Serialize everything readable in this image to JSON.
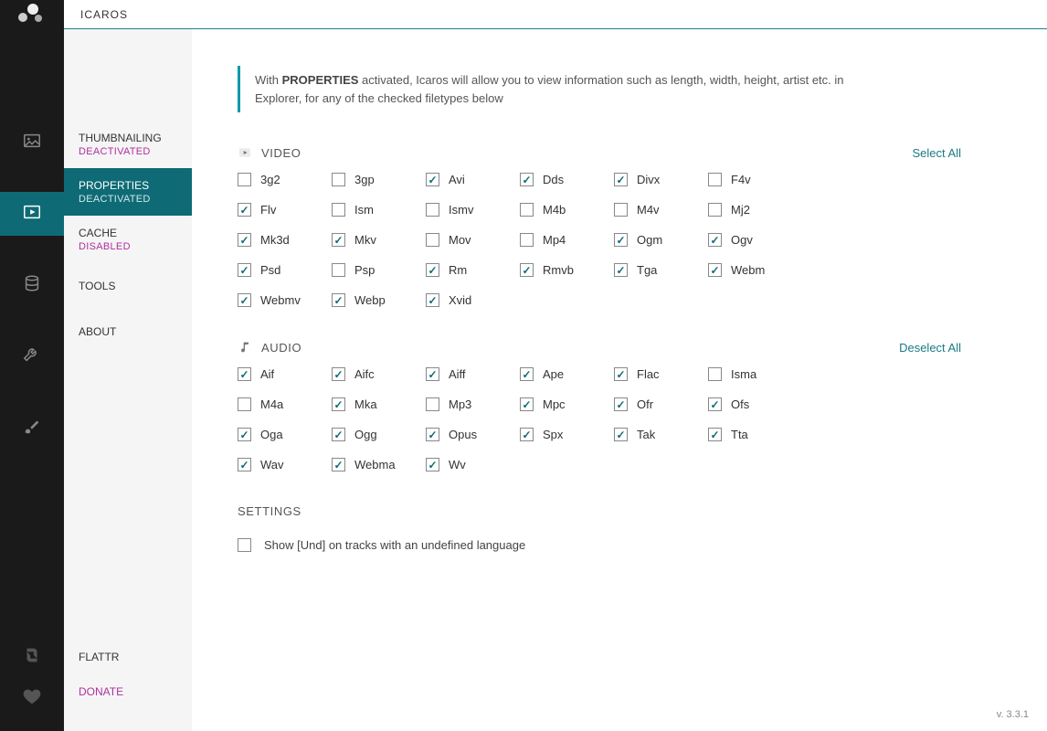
{
  "app_title": "ICAROS",
  "version_label": "v. 3.3.1",
  "sidebar": {
    "items": [
      {
        "label": "THUMBNAILING",
        "status": "DEACTIVATED",
        "active": false
      },
      {
        "label": "PROPERTIES",
        "status": "DEACTIVATED",
        "active": true
      },
      {
        "label": "CACHE",
        "status": "DISABLED",
        "active": false
      },
      {
        "label": "TOOLS",
        "status": "",
        "active": false
      },
      {
        "label": "ABOUT",
        "status": "",
        "active": false
      }
    ],
    "bottom": {
      "flattr": "FLATTR",
      "donate": "DONATE"
    }
  },
  "intro": {
    "pre": "With ",
    "highlight": "PROPERTIES",
    "post": " activated, Icaros will allow you to view information such as length, width, height, artist etc. in Explorer, for any of the checked filetypes below"
  },
  "sections": {
    "video": {
      "title": "VIDEO",
      "action": "Select All",
      "items": [
        {
          "label": "3g2",
          "checked": false
        },
        {
          "label": "3gp",
          "checked": false
        },
        {
          "label": "Avi",
          "checked": true
        },
        {
          "label": "Dds",
          "checked": true
        },
        {
          "label": "Divx",
          "checked": true
        },
        {
          "label": "F4v",
          "checked": false
        },
        {
          "label": "Flv",
          "checked": true
        },
        {
          "label": "Ism",
          "checked": false
        },
        {
          "label": "Ismv",
          "checked": false
        },
        {
          "label": "M4b",
          "checked": false
        },
        {
          "label": "M4v",
          "checked": false
        },
        {
          "label": "Mj2",
          "checked": false
        },
        {
          "label": "Mk3d",
          "checked": true
        },
        {
          "label": "Mkv",
          "checked": true
        },
        {
          "label": "Mov",
          "checked": false
        },
        {
          "label": "Mp4",
          "checked": false
        },
        {
          "label": "Ogm",
          "checked": true
        },
        {
          "label": "Ogv",
          "checked": true
        },
        {
          "label": "Psd",
          "checked": true
        },
        {
          "label": "Psp",
          "checked": false
        },
        {
          "label": "Rm",
          "checked": true
        },
        {
          "label": "Rmvb",
          "checked": true
        },
        {
          "label": "Tga",
          "checked": true
        },
        {
          "label": "Webm",
          "checked": true
        },
        {
          "label": "Webmv",
          "checked": true
        },
        {
          "label": "Webp",
          "checked": true
        },
        {
          "label": "Xvid",
          "checked": true
        }
      ]
    },
    "audio": {
      "title": "AUDIO",
      "action": "Deselect All",
      "items": [
        {
          "label": "Aif",
          "checked": true
        },
        {
          "label": "Aifc",
          "checked": true
        },
        {
          "label": "Aiff",
          "checked": true
        },
        {
          "label": "Ape",
          "checked": true
        },
        {
          "label": "Flac",
          "checked": true
        },
        {
          "label": "Isma",
          "checked": false
        },
        {
          "label": "M4a",
          "checked": false
        },
        {
          "label": "Mka",
          "checked": true
        },
        {
          "label": "Mp3",
          "checked": false
        },
        {
          "label": "Mpc",
          "checked": true
        },
        {
          "label": "Ofr",
          "checked": true
        },
        {
          "label": "Ofs",
          "checked": true
        },
        {
          "label": "Oga",
          "checked": true
        },
        {
          "label": "Ogg",
          "checked": true
        },
        {
          "label": "Opus",
          "checked": true
        },
        {
          "label": "Spx",
          "checked": true
        },
        {
          "label": "Tak",
          "checked": true
        },
        {
          "label": "Tta",
          "checked": true
        },
        {
          "label": "Wav",
          "checked": true
        },
        {
          "label": "Webma",
          "checked": true
        },
        {
          "label": "Wv",
          "checked": true
        }
      ]
    }
  },
  "settings": {
    "title": "SETTINGS",
    "und": {
      "label": "Show [Und] on tracks with an undefined language",
      "checked": false
    }
  }
}
